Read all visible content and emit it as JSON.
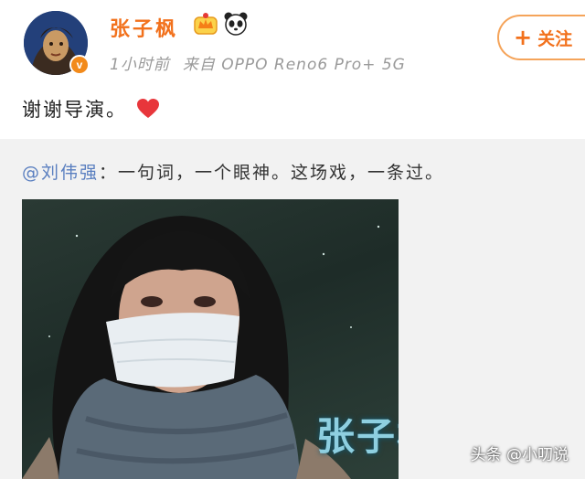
{
  "post": {
    "username": "张子枫",
    "time": "1小时前",
    "source": "来自 OPPO Reno6 Pro+ 5G",
    "follow_label": "关注",
    "follow_plus": "+",
    "vip_badge": "v",
    "text": "谢谢导演。",
    "icons": [
      "crown-icon",
      "panda-icon",
      "heart-icon"
    ]
  },
  "repost": {
    "mention": "@刘伟强",
    "text": "：一句词，一个眼神。这场戏，一条过。",
    "overlay_name": "张子枫"
  },
  "watermark": "头条 @小叨说",
  "colors": {
    "username": "#f2711c",
    "mention": "#5a7fc0",
    "repost_bg": "#f2f2f2",
    "heart": "#e8363b"
  }
}
